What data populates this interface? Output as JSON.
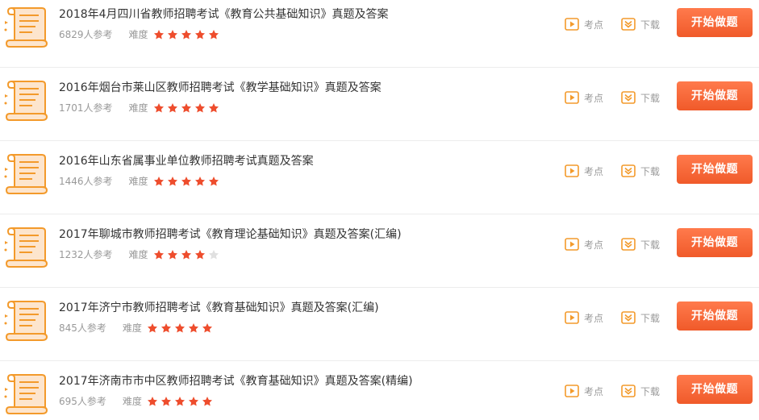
{
  "colors": {
    "accent": "#f05a2a",
    "star_on": "#ee4d2d",
    "star_off": "#e0e0e0",
    "icon_orange": "#f39a2b",
    "doc_fill": "#fde5cd"
  },
  "labels": {
    "kaodian": "考点",
    "download": "下载",
    "start": "开始做题",
    "difficulty": "难度"
  },
  "items": [
    {
      "title": "2018年4月四川省教师招聘考试《教育公共基础知识》真题及答案",
      "participants": "6829人参考",
      "difficulty": 5
    },
    {
      "title": "2016年烟台市莱山区教师招聘考试《教学基础知识》真题及答案",
      "participants": "1701人参考",
      "difficulty": 5
    },
    {
      "title": "2016年山东省属事业单位教师招聘考试真题及答案",
      "participants": "1446人参考",
      "difficulty": 5
    },
    {
      "title": "2017年聊城市教师招聘考试《教育理论基础知识》真题及答案(汇编)",
      "participants": "1232人参考",
      "difficulty": 4
    },
    {
      "title": "2017年济宁市教师招聘考试《教育基础知识》真题及答案(汇编)",
      "participants": "845人参考",
      "difficulty": 5
    },
    {
      "title": "2017年济南市市中区教师招聘考试《教育基础知识》真题及答案(精编)",
      "participants": "695人参考",
      "difficulty": 5
    }
  ]
}
